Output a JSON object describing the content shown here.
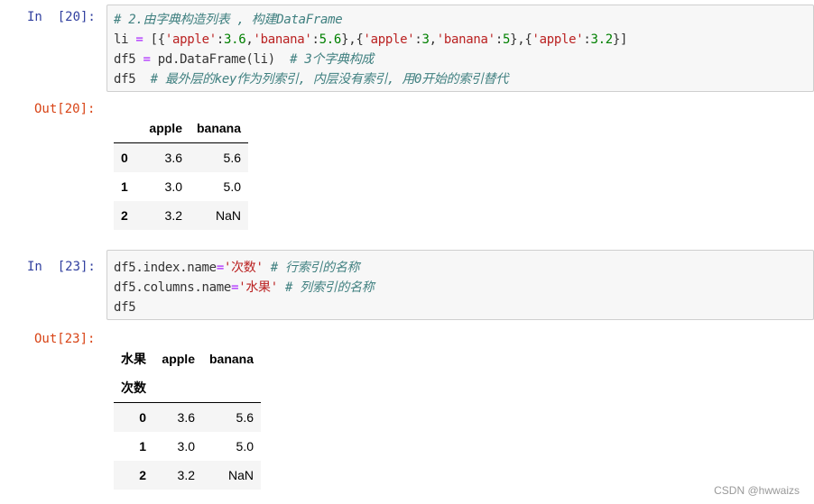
{
  "cells": [
    {
      "in_prompt": "In  [20]:",
      "out_prompt": "Out[20]:",
      "code": [
        "# 2.由字典构造列表 , 构建DataFrame",
        "li = [{'apple':3.6,'banana':5.6},{'apple':3,'banana':5},{'apple':3.2}]",
        "df5 = pd.DataFrame(li)  # 3个字典构成",
        "df5  # 最外层的key作为列索引, 内层没有索引, 用0开始的索引替代"
      ],
      "output": {
        "columns": [
          "",
          "apple",
          "banana"
        ],
        "rows": [
          {
            "index": "0",
            "values": [
              "3.6",
              "5.6"
            ]
          },
          {
            "index": "1",
            "values": [
              "3.0",
              "5.0"
            ]
          },
          {
            "index": "2",
            "values": [
              "3.2",
              "NaN"
            ]
          }
        ]
      }
    },
    {
      "in_prompt": "In  [23]:",
      "out_prompt": "Out[23]:",
      "code": [
        "df5.index.name='次数' # 行索引的名称",
        "df5.columns.name='水果' # 列索引的名称",
        "df5"
      ],
      "output": {
        "columns_name": "水果",
        "columns": [
          "apple",
          "banana"
        ],
        "index_name": "次数",
        "rows": [
          {
            "index": "0",
            "values": [
              "3.6",
              "5.6"
            ]
          },
          {
            "index": "1",
            "values": [
              "3.0",
              "5.0"
            ]
          },
          {
            "index": "2",
            "values": [
              "3.2",
              "NaN"
            ]
          }
        ]
      }
    }
  ],
  "watermark": "CSDN @hwwaizs",
  "colors": {
    "in_prompt": "#303f9f",
    "out_prompt": "#d84315",
    "comment": "#408080",
    "string": "#ba2121",
    "number": "#008000"
  }
}
